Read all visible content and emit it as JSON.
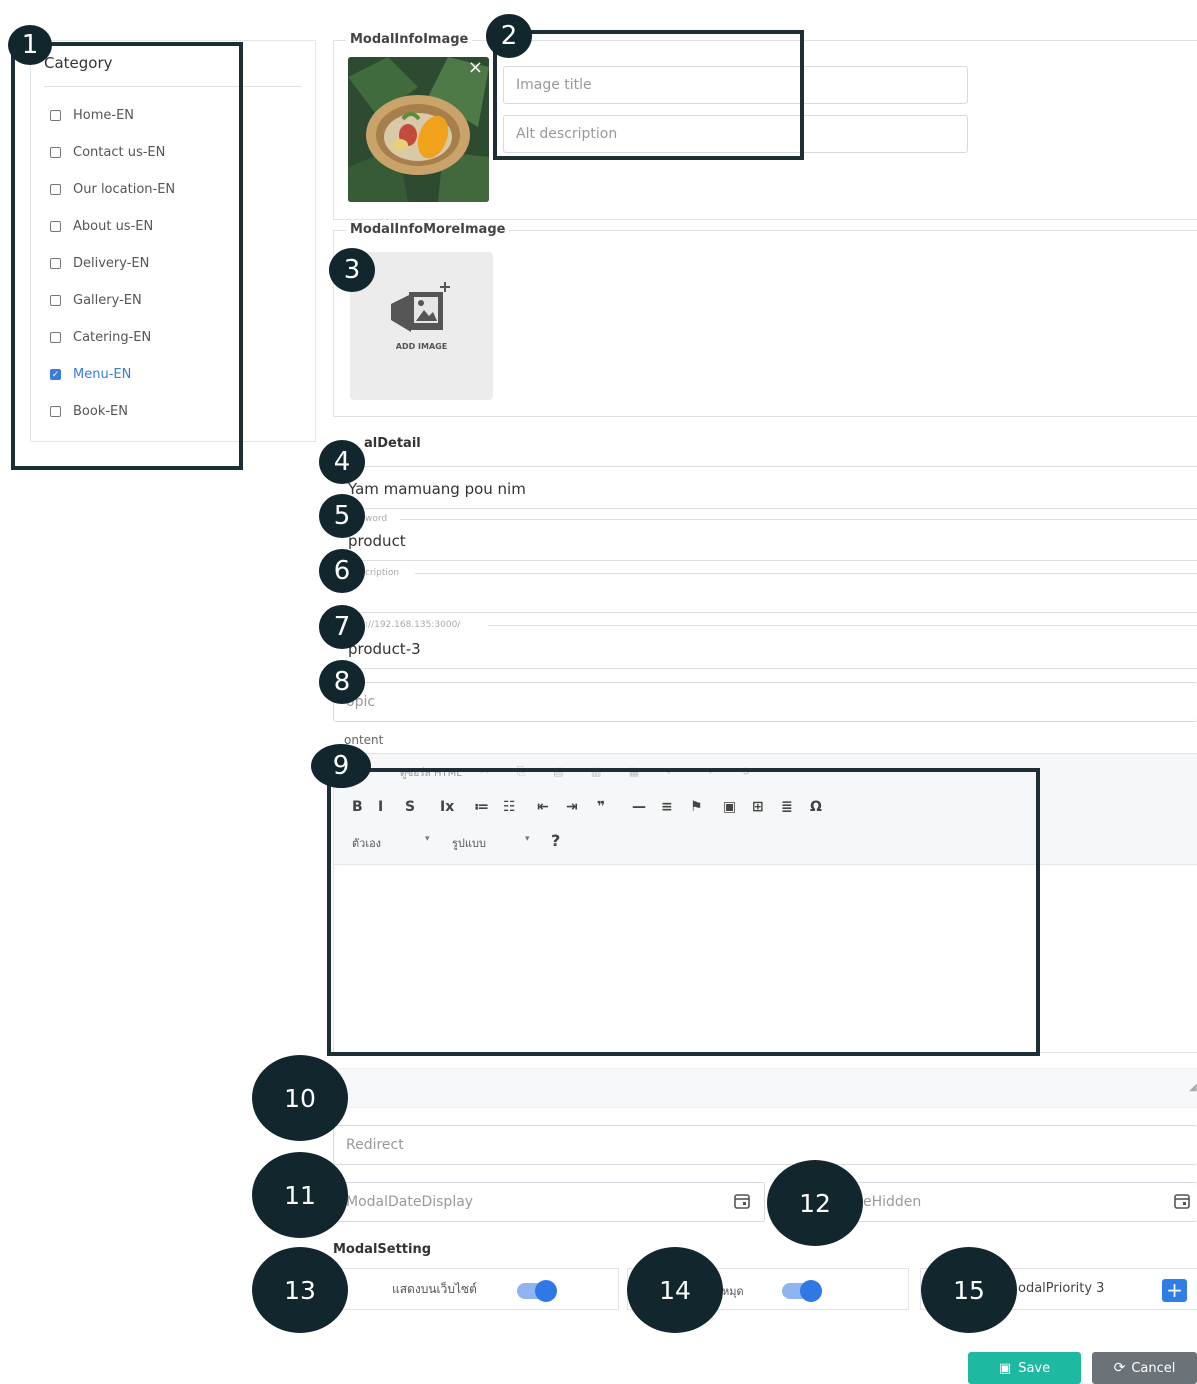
{
  "category": {
    "title": "Category",
    "items": [
      {
        "label": "Home-EN",
        "checked": false
      },
      {
        "label": "Contact us-EN",
        "checked": false
      },
      {
        "label": "Our location-EN",
        "checked": false
      },
      {
        "label": "About us-EN",
        "checked": false
      },
      {
        "label": "Delivery-EN",
        "checked": false
      },
      {
        "label": "Gallery-EN",
        "checked": false
      },
      {
        "label": "Catering-EN",
        "checked": false
      },
      {
        "label": "Menu-EN",
        "checked": true
      },
      {
        "label": "Book-EN",
        "checked": false
      }
    ]
  },
  "image_section": {
    "legend": "ModalInfoImage",
    "remove_glyph": "×",
    "image_title_placeholder": "Image title",
    "alt_placeholder": "Alt description"
  },
  "more_image_section": {
    "legend": "ModalInfoMoreImage",
    "add_image_label": "ADD IMAGE"
  },
  "detail": {
    "legend": "alDetail",
    "name_value": "Yam mamuang pou nim",
    "keyword_label": "word",
    "keyword_value": "product",
    "description_label": "cription",
    "url_prefix": "://192.168.135:3000/",
    "url_value": "product-3",
    "topic_placeholder": "opic"
  },
  "content": {
    "label": "ontent",
    "toolbar_row1_text": "ดูซอร์ส HTML",
    "toolbar_row2": [
      "B",
      "I",
      "S",
      "Ix",
      "≔",
      "☷",
      "⇤",
      "⇥",
      "❞",
      "—",
      "≡",
      "⚑",
      "▣",
      "⊞",
      "≣",
      "Ω"
    ],
    "font_select": "ตัวเอง",
    "format_select": "รูปแบบ",
    "help": "?"
  },
  "redirect_placeholder": "Redirect",
  "date_display_placeholder": "ModalDateDisplay",
  "date_hidden_placeholder": "eHidden",
  "settings": {
    "legend": "ModalSetting",
    "toggle1_label": "แสดงบนเว็บไซต์",
    "toggle2_label": "หมุด",
    "priority_label": "odalPriority 3",
    "toggle1_on": true,
    "toggle2_on": true
  },
  "buttons": {
    "save": "Save",
    "cancel": "Cancel",
    "save_color": "#1fb8a1",
    "cancel_color": "#6b7278"
  },
  "annotations": [
    "1",
    "2",
    "3",
    "4",
    "5",
    "6",
    "7",
    "8",
    "9",
    "10",
    "11",
    "12",
    "13",
    "14",
    "15"
  ]
}
